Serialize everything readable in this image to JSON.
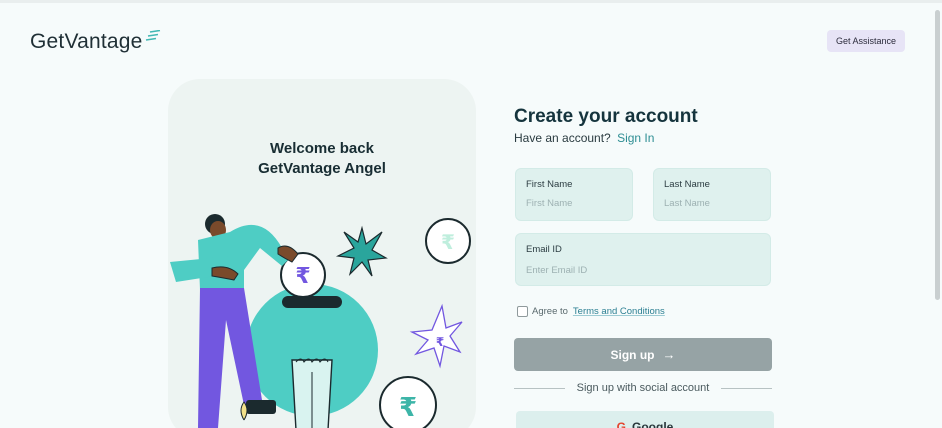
{
  "header": {
    "logo_text": "GetVantage",
    "assist_label": "Get Assistance"
  },
  "card": {
    "welcome_line1": "Welcome back",
    "welcome_line2": "GetVantage Angel"
  },
  "form": {
    "title": "Create your account",
    "have_account": "Have an account?",
    "sign_in": "Sign In",
    "first_name_label": "First Name",
    "first_name_placeholder": "First Name",
    "last_name_label": "Last Name",
    "last_name_placeholder": "Last Name",
    "email_label": "Email ID",
    "email_placeholder": "Enter Email ID",
    "agree_text": "Agree to",
    "terms_link": "Terms and Conditions",
    "signup_label": "Sign up",
    "social_divider": "Sign up with social account",
    "google_label": "Google"
  },
  "colors": {
    "accent": "#2e8e93",
    "signup_button": "#96a3a5",
    "field_bg": "#dff1ee",
    "illustration_teal": "#4ecdc4",
    "illustration_purple": "#7257e0"
  },
  "icons": [
    "logo-mark-icon",
    "arrow-right-icon",
    "google-icon",
    "rupee-coin-icon",
    "star-burst-icon"
  ]
}
